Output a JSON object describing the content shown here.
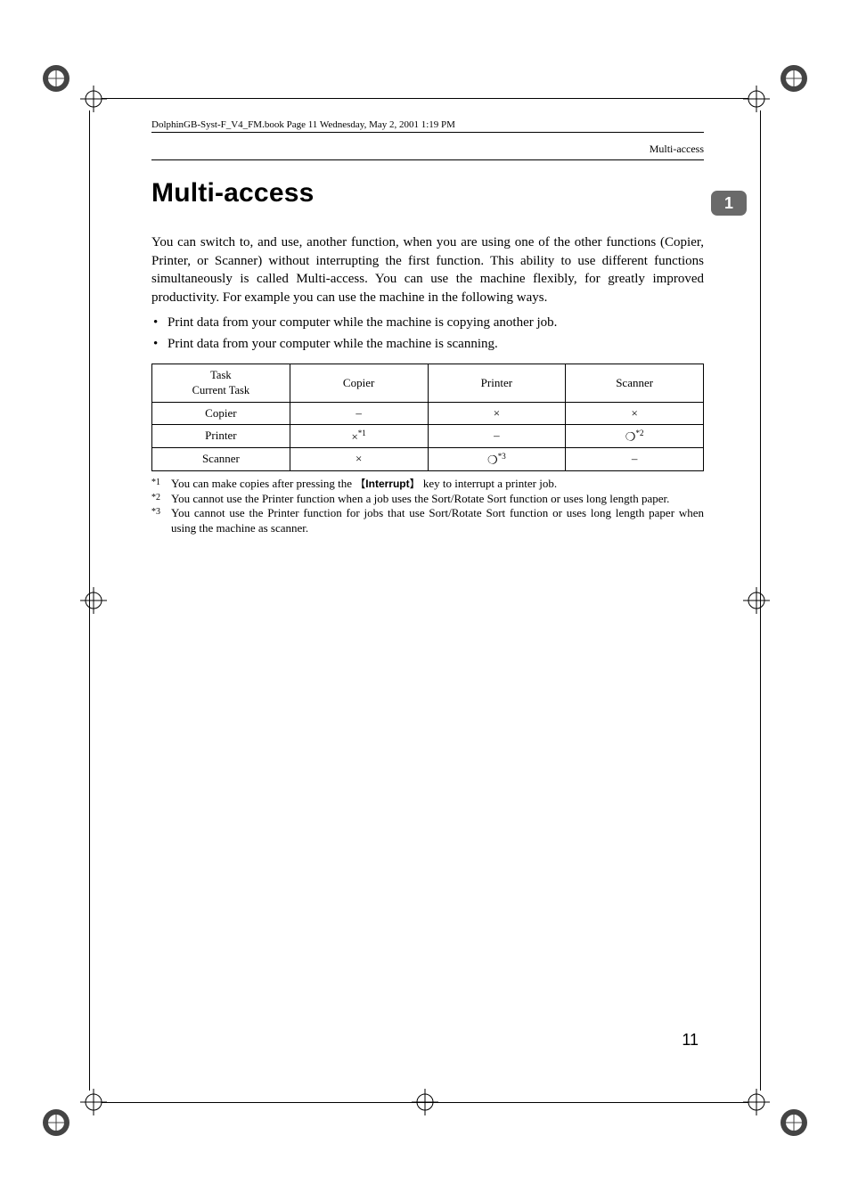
{
  "running_head": "DolphinGB-Syst-F_V4_FM.book  Page 11  Wednesday, May 2, 2001  1:19 PM",
  "header_title": "Multi-access",
  "section_number": "1",
  "title": "Multi-access",
  "intro": "You can switch to, and use, another function, when you are using one of the other functions (Copier, Printer, or Scanner) without interrupting the first function. This ability to use different functions simultaneously is called Multi-access. You can use the machine flexibly, for greatly improved productivity. For example you can use the machine in the following ways.",
  "bullets": [
    "Print data from your computer while the machine is copying another job.",
    "Print data from your computer while the machine is scanning."
  ],
  "table": {
    "corner_top": "Task",
    "corner_bottom": "Current Task",
    "cols": [
      "Copier",
      "Printer",
      "Scanner"
    ],
    "rows": [
      {
        "label": "Copier",
        "cells": [
          {
            "v": "–"
          },
          {
            "v": "×"
          },
          {
            "v": "×"
          }
        ]
      },
      {
        "label": "Printer",
        "cells": [
          {
            "v": "×",
            "sup": "*1"
          },
          {
            "v": "–"
          },
          {
            "v": "❍",
            "sup": "*2"
          }
        ]
      },
      {
        "label": "Scanner",
        "cells": [
          {
            "v": "×"
          },
          {
            "v": "❍",
            "sup": "*3"
          },
          {
            "v": "–"
          }
        ]
      }
    ]
  },
  "footnotes": [
    {
      "mark": "*1",
      "pre": "You can make copies after pressing the ",
      "key": "Interrupt",
      "post": " key to interrupt a printer job."
    },
    {
      "mark": "*2",
      "text": "You cannot use the Printer function when a job uses the Sort/Rotate Sort function or uses long length paper."
    },
    {
      "mark": "*3",
      "text": "You cannot use the Printer function for jobs that use Sort/Rotate Sort function or uses long length paper when using the machine as scanner."
    }
  ],
  "page_number": "11"
}
